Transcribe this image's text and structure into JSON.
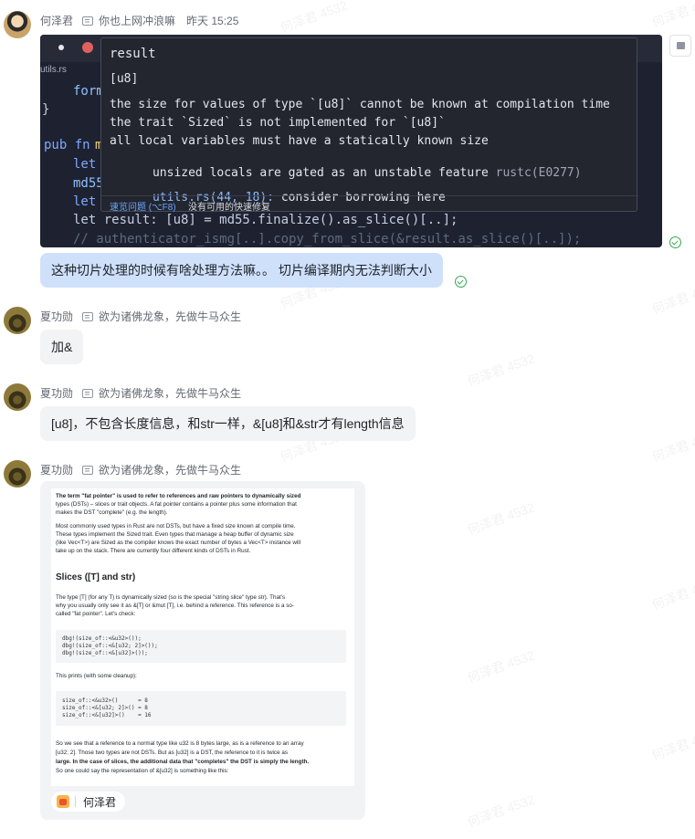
{
  "watermark": "何泽君 4532",
  "messages": [
    {
      "sender": "何泽君",
      "signature": "你也上网冲浪嘛",
      "time": "昨天 15:25",
      "code_screenshot": {
        "tab_file": "utils.rs",
        "code_lines": {
          "l1": "form",
          "l2": "}",
          "l3_kw": "pub fn",
          "l3_fn": "m",
          "l4": "let",
          "l5": "md55",
          "l6": "let",
          "l7": "let result: [u8] = md55.finalize().as_slice()[..];",
          "l8": "// authenticator_ismg[..].copy_from_slice(&result.as_slice()[..]);"
        },
        "tooltip": {
          "title": "result",
          "type": "[u8]",
          "lines": [
            "the size for values of type `[u8]` cannot be known at compilation time",
            "the trait `Sized` is not implemented for `[u8]`",
            "all local variables must have a statically known size",
            "unsized locals are gated as an unstable feature"
          ],
          "code": "rustc(E0277)",
          "location": "utils.rs(44, 18):",
          "hint": "consider borrowing here",
          "quick_fix_link": "速览问题 (⌥F8)",
          "no_fix": "没有可用的快速修复"
        }
      },
      "text": "这种切片处理的时候有啥处理方法嘛。。 切片编译期内无法判断大小"
    },
    {
      "sender": "夏功勋",
      "signature": "欲为诸佛龙象，先做牛马众生",
      "text": "加&"
    },
    {
      "sender": "夏功勋",
      "signature": "欲为诸佛龙象，先做牛马众生",
      "text": "[u8]，不包含长度信息，和str一样，&[u8]和&str才有length信息"
    },
    {
      "sender": "夏功勋",
      "signature": "欲为诸佛龙象，先做牛马众生",
      "doc": {
        "p1a": "The term \"fat pointer\" is used to refer to references and raw pointers to dynamically sized",
        "p1b": "types (DSTs) – slices or trait objects. A fat pointer contains a pointer plus some information that",
        "p1c": "makes the DST \"complete\" (e.g. the length).",
        "p2a": "Most commonly used types in Rust are not DSTs, but have a fixed size known at compile time.",
        "p2b": "These types implement the Sized trait. Even types that manage a heap buffer of dynamic size",
        "p2c": "(like Vec<T>) are Sized as the compiler knows the exact number of bytes a Vec<T> instance will",
        "p2d": "take up on the stack. There are currently four different kinds of DSTs in Rust.",
        "heading": "Slices ([T] and str)",
        "p3a": "The type [T] (for any T) is dynamically sized (so is the special \"string slice\" type str). That's",
        "p3b": "why you usually only see it as &[T] or &mut [T], i.e. behind a reference. This reference is a so-",
        "p3c": "called \"fat pointer\". Let's check:",
        "code1": [
          "dbg!(size_of::<&u32>());",
          "dbg!(size_of::<&[u32; 2]>());",
          "dbg!(size_of::<&[u32]>());"
        ],
        "p4": "This prints (with some cleanup):",
        "code2": [
          "size_of::<&u32>()      = 8",
          "size_of::<&[u32; 2]>() = 8",
          "size_of::<&[u32]>()    = 16"
        ],
        "p5a": "So we see that a reference to a normal type like u32 is 8 bytes large, as is a reference to an array",
        "p5b": "[u32; 2]. Those two types are not DSTs. But as [u32] is a DST, the reference to it is twice as",
        "p5c": "large. In the case of slices, the additional data that \"completes\" the DST is simply the length.",
        "p5d": "So one could say the representation of &[u32] is something like this:"
      },
      "reaction_user": "何泽君"
    }
  ]
}
